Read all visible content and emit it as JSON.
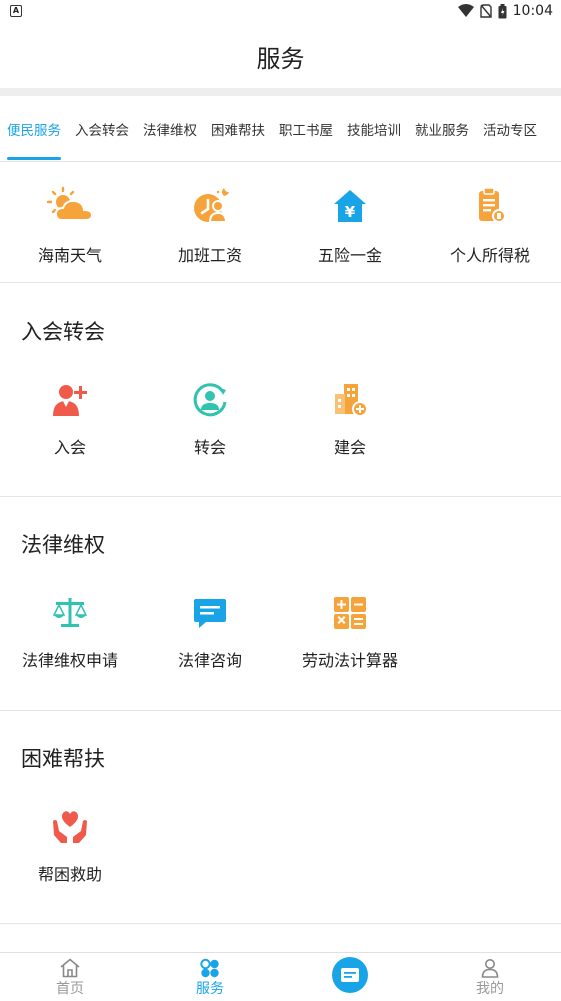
{
  "status_bar": {
    "time": "10:04",
    "notif_letter": "A"
  },
  "header": {
    "title": "服务"
  },
  "tabs": [
    {
      "label": "便民服务",
      "active": true
    },
    {
      "label": "入会转会"
    },
    {
      "label": "法律维权"
    },
    {
      "label": "困难帮扶"
    },
    {
      "label": "职工书屋"
    },
    {
      "label": "技能培训"
    },
    {
      "label": "就业服务"
    },
    {
      "label": "活动专区"
    }
  ],
  "convenience": {
    "items": [
      {
        "label": "海南天气",
        "icon": "weather-icon"
      },
      {
        "label": "加班工资",
        "icon": "overtime-pay-icon"
      },
      {
        "label": "五险一金",
        "icon": "insurance-fund-icon"
      },
      {
        "label": "个人所得税",
        "icon": "income-tax-icon"
      }
    ]
  },
  "sections": {
    "membership": {
      "title": "入会转会",
      "items": [
        {
          "label": "入会",
          "icon": "join-union-icon"
        },
        {
          "label": "转会",
          "icon": "transfer-union-icon"
        },
        {
          "label": "建会",
          "icon": "build-union-icon"
        }
      ]
    },
    "legal": {
      "title": "法律维权",
      "items": [
        {
          "label": "法律维权申请",
          "icon": "scales-icon"
        },
        {
          "label": "法律咨询",
          "icon": "chat-icon"
        },
        {
          "label": "劳动法计算器",
          "icon": "calculator-icon"
        }
      ]
    },
    "assistance": {
      "title": "困难帮扶",
      "items": [
        {
          "label": "帮困救助",
          "icon": "heart-hands-icon"
        }
      ]
    }
  },
  "bottom_nav": {
    "home": "首页",
    "service": "服务",
    "mine": "我的"
  },
  "colors": {
    "accent": "#1aa4e8",
    "orange": "#f5a33a",
    "red": "#ef5a4b",
    "teal": "#2fc3b0"
  }
}
